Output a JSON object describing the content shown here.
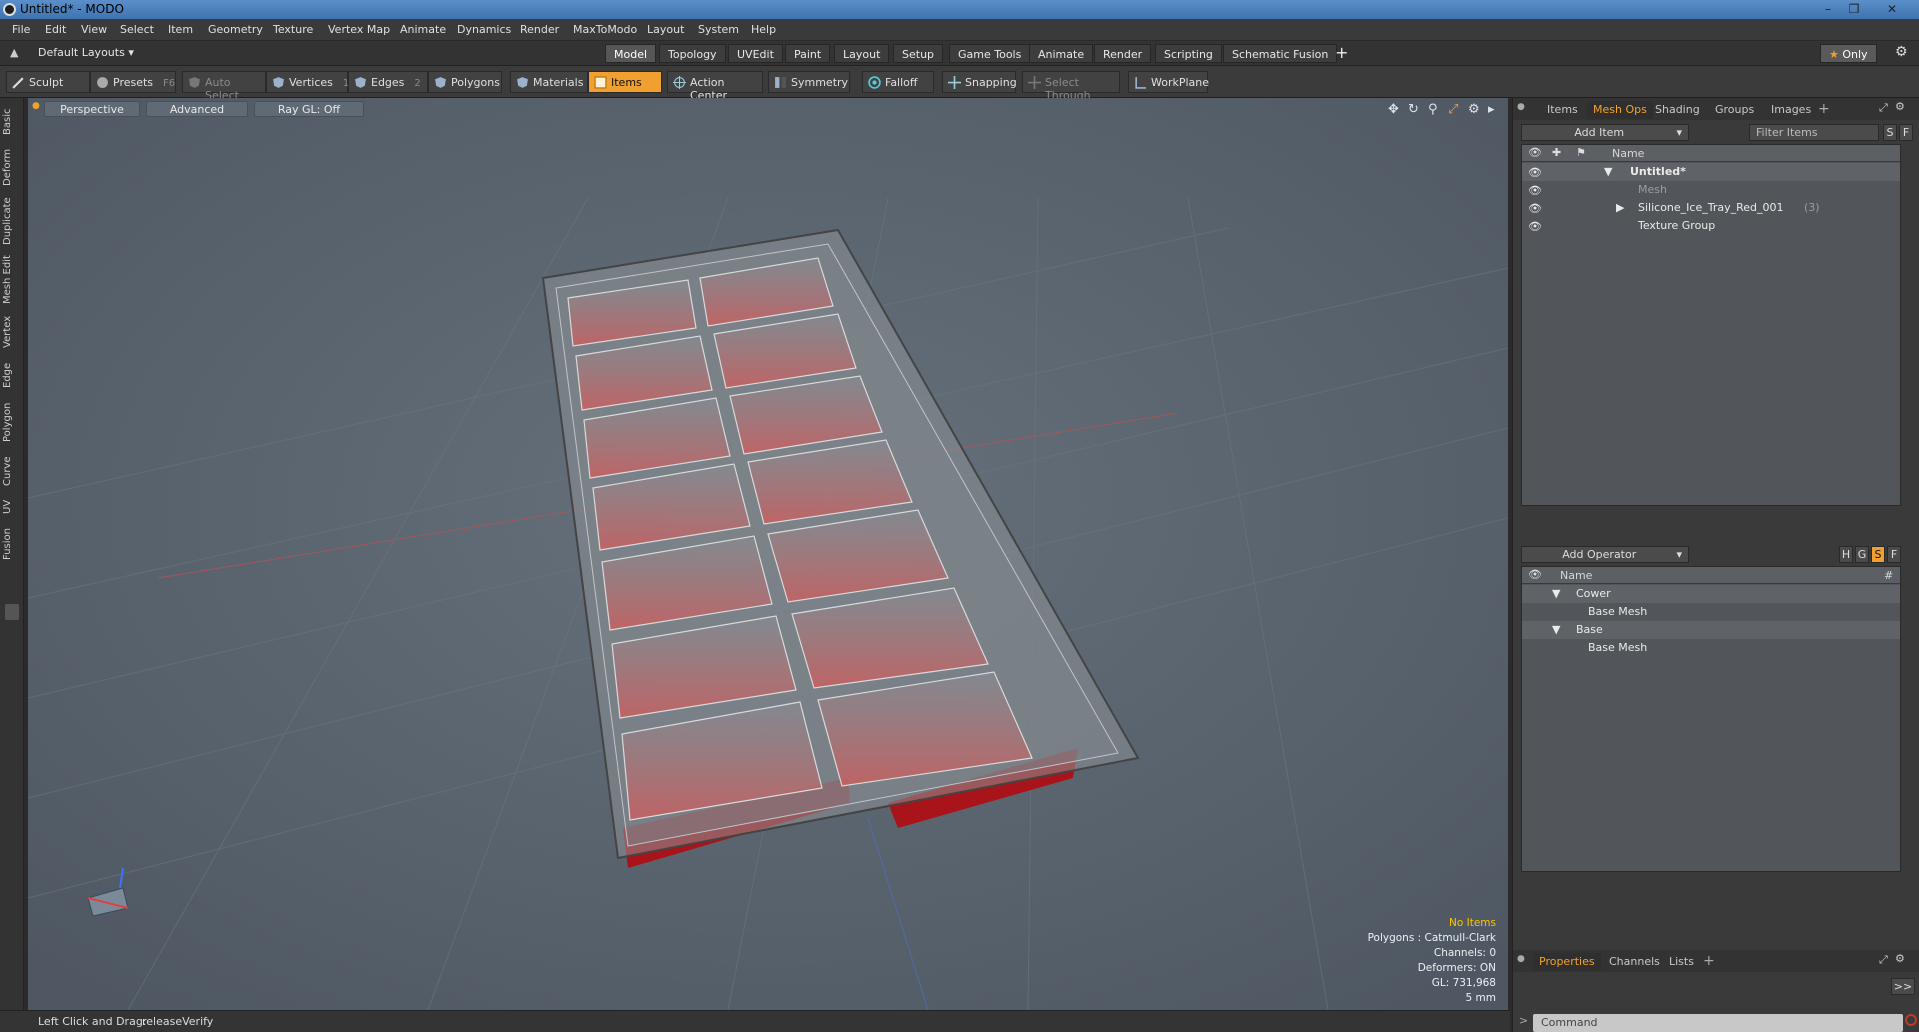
{
  "window": {
    "title": "Untitled* - MODO"
  },
  "menu": [
    "File",
    "Edit",
    "View",
    "Select",
    "Item",
    "Geometry",
    "Texture",
    "Vertex Map",
    "Animate",
    "Dynamics",
    "Render",
    "MaxToModo",
    "Layout",
    "System",
    "Help"
  ],
  "layout_selector": "Default Layouts",
  "layout_tabs": [
    "Model",
    "Topology",
    "UVEdit",
    "Paint",
    "Layout",
    "Setup",
    "Game Tools",
    "Animate",
    "Render",
    "Scripting",
    "Schematic Fusion"
  ],
  "active_layout_tab": "Model",
  "only_label": "Only",
  "toolbar": {
    "sculpt": "Sculpt",
    "presets": "Presets",
    "presets_key": "F6",
    "auto_select": "Auto Select",
    "vertices": "Vertices",
    "vertices_key": "1",
    "edges": "Edges",
    "edges_key": "2",
    "polygons": "Polygons",
    "materials": "Materials",
    "items": "Items",
    "action_center": "Action Center",
    "symmetry": "Symmetry",
    "falloff": "Falloff",
    "snapping": "Snapping",
    "select_through": "Select Through",
    "workplane": "WorkPlane"
  },
  "left_tabs": [
    "Basic",
    "Deform",
    "Duplicate",
    "Mesh Edit",
    "Vertex",
    "Edge",
    "Polygon",
    "Curve",
    "UV",
    "Fusion"
  ],
  "viewport": {
    "view_mode": "Perspective",
    "advanced": "Advanced",
    "raygl": "Ray GL: Off",
    "info": {
      "selection": "No Items",
      "polygons": "Polygons : Catmull-Clark",
      "channels": "Channels: 0",
      "deformers": "Deformers: ON",
      "gl": "GL: 731,968",
      "scale": "5 mm"
    }
  },
  "status": {
    "hint": "Left Click and Drag:",
    "command": "releaseVerify"
  },
  "items_panel": {
    "tabs": [
      "Items",
      "Mesh Ops",
      "Shading",
      "Groups",
      "Images"
    ],
    "active_tab": "Mesh Ops",
    "add_item": "Add Item",
    "filter_placeholder": "Filter Items",
    "col_name": "Name",
    "rows": [
      {
        "label": "Untitled*",
        "indent": 0
      },
      {
        "label": "Mesh",
        "indent": 1
      },
      {
        "label": "Silicone_Ice_Tray_Red_001",
        "extra": "(3)",
        "indent": 1
      },
      {
        "label": "Texture Group",
        "indent": 1
      }
    ]
  },
  "meshops_panel": {
    "add_operator": "Add Operator",
    "col_name": "Name",
    "col_hash": "#",
    "rows": [
      {
        "label": "Cower",
        "indent": 0
      },
      {
        "label": "Base Mesh",
        "indent": 1
      },
      {
        "label": "Base",
        "indent": 0
      },
      {
        "label": "Base Mesh",
        "indent": 1
      }
    ],
    "toggles": [
      "H",
      "G",
      "S",
      "F"
    ]
  },
  "properties_panel": {
    "tabs": [
      "Properties",
      "Channels",
      "Lists"
    ],
    "active_tab": "Properties",
    "command_placeholder": "Command",
    "expand": ">>"
  },
  "colors": {
    "accent_orange": "#f0a030",
    "viewport_bg": "#5b6570",
    "tray_red": "#c0262a"
  }
}
